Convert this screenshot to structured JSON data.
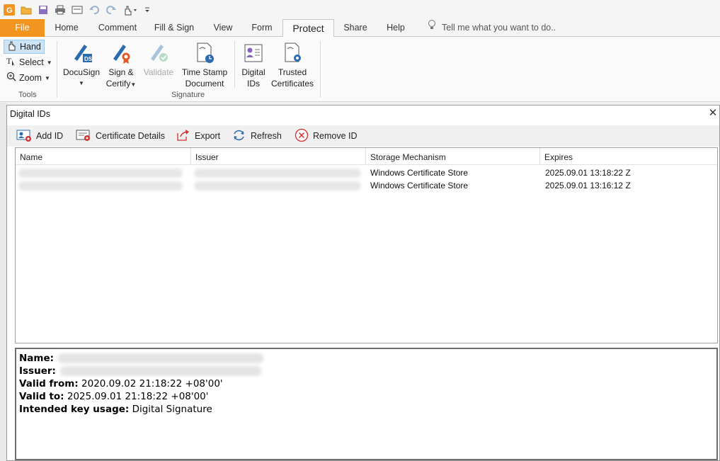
{
  "quick_access": {
    "icons": [
      "app-logo-icon",
      "open-folder-icon",
      "save-icon",
      "print-icon",
      "screen-icon",
      "undo-icon",
      "redo-icon",
      "hand-tool-icon",
      "customize-icon"
    ]
  },
  "tabs": [
    {
      "label": "File"
    },
    {
      "label": "Home"
    },
    {
      "label": "Comment"
    },
    {
      "label": "Fill & Sign"
    },
    {
      "label": "View"
    },
    {
      "label": "Form"
    },
    {
      "label": "Protect"
    },
    {
      "label": "Share"
    },
    {
      "label": "Help"
    }
  ],
  "tell_me": "Tell me what you want to do..",
  "ribbon": {
    "tools": {
      "hand": "Hand",
      "select": "Select",
      "zoom": "Zoom",
      "group_label": "Tools"
    },
    "signature": {
      "docusign": "DocuSign",
      "sign_line1": "Sign &",
      "sign_line2": "Certify",
      "validate": "Validate",
      "timestamp_line1": "Time Stamp",
      "timestamp_line2": "Document",
      "digital_line1": "Digital",
      "digital_line2": "IDs",
      "trusted_line1": "Trusted",
      "trusted_line2": "Certificates",
      "group_label": "Signature"
    }
  },
  "dialog": {
    "title": "Digital IDs",
    "close": "✕",
    "toolbar": {
      "add_id": "Add ID",
      "certificate_details": "Certificate Details",
      "export": "Export",
      "refresh": "Refresh",
      "remove_id": "Remove ID"
    },
    "columns": {
      "name": "Name",
      "issuer": "Issuer",
      "storage": "Storage Mechanism",
      "expires": "Expires"
    },
    "rows": [
      {
        "storage": "Windows Certificate Store",
        "expires": "2025.09.01 13:18:22 Z"
      },
      {
        "storage": "Windows Certificate Store",
        "expires": "2025.09.01 13:16:12 Z"
      }
    ],
    "details": {
      "name_label": "Name:",
      "issuer_label": "Issuer:",
      "valid_from_label": "Valid from:",
      "valid_from": "2020.09.02 21:18:22 +08'00'",
      "valid_to_label": "Valid to:",
      "valid_to": "2025.09.01 21:18:22 +08'00'",
      "usage_label": "Intended key usage:",
      "usage": "Digital Signature"
    }
  },
  "colors": {
    "file_tab": "#f39421",
    "accent_blue": "#2b6cb0",
    "remove_red": "#d32f2f"
  }
}
